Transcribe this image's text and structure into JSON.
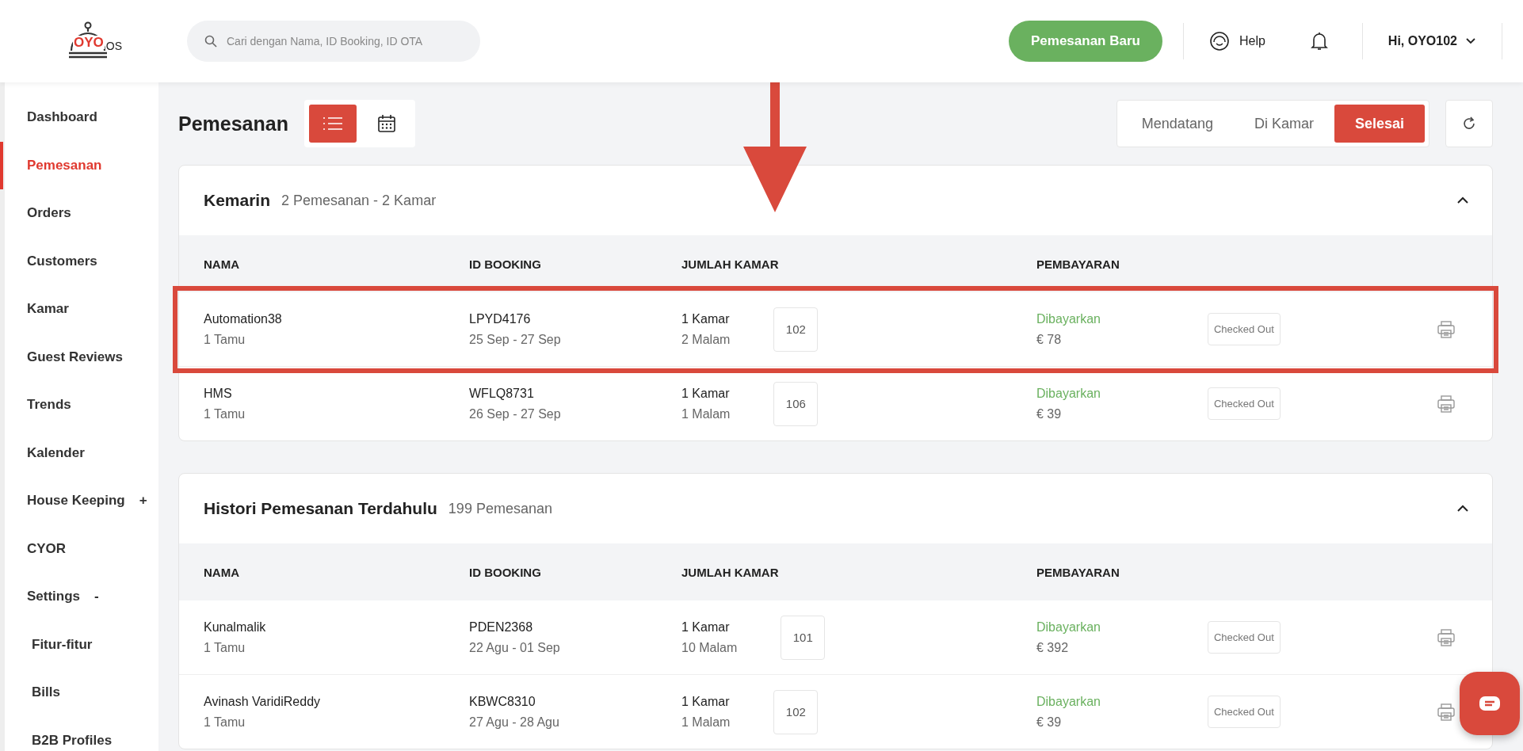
{
  "logo": {
    "brand": "OYO",
    "suffix": "OS"
  },
  "search": {
    "placeholder": "Cari dengan Nama, ID Booking, ID OTA"
  },
  "header": {
    "new_booking": "Pemesanan Baru",
    "help": "Help",
    "user": "Hi, OYO102"
  },
  "sidebar": {
    "items": [
      {
        "label": "Dashboard",
        "selected": false
      },
      {
        "label": "Pemesanan",
        "selected": true
      },
      {
        "label": "Orders",
        "selected": false
      },
      {
        "label": "Customers",
        "selected": false
      },
      {
        "label": "Kamar",
        "selected": false
      },
      {
        "label": "Guest Reviews",
        "selected": false
      },
      {
        "label": "Trends",
        "selected": false
      },
      {
        "label": "Kalender",
        "selected": false
      },
      {
        "label": "House Keeping",
        "selected": false,
        "toggle": "+"
      },
      {
        "label": "CYOR",
        "selected": false
      },
      {
        "label": "Settings",
        "selected": false,
        "toggle": "-",
        "children": [
          {
            "label": "Fitur-fitur",
            "selected": false
          },
          {
            "label": "Bills",
            "selected": false
          },
          {
            "label": "B2B Profiles",
            "selected": false
          }
        ]
      }
    ]
  },
  "page": {
    "title": "Pemesanan",
    "views": [
      {
        "kind": "list",
        "selected": true
      },
      {
        "kind": "calendar",
        "selected": false
      }
    ],
    "tabs": [
      {
        "label": "Mendatang",
        "selected": false
      },
      {
        "label": "Di Kamar",
        "selected": false
      },
      {
        "label": "Selesai",
        "selected": true
      }
    ]
  },
  "sections": [
    {
      "title": "Kemarin",
      "summary": "2 Pemesanan - 2 Kamar",
      "expanded": true,
      "columns": [
        "NAMA",
        "ID BOOKING",
        "JUMLAH KAMAR",
        "PEMBAYARAN"
      ],
      "rows": [
        {
          "name": "Automation38",
          "guests": "1 Tamu",
          "booking_id": "LPYD4176",
          "dates": "25 Sep - 27 Sep",
          "rooms": "1 Kamar",
          "nights": "2 Malam",
          "room_no": "102",
          "payment": "Dibayarkan",
          "amount": "€ 78",
          "status": "Checked Out",
          "highlighted": true
        },
        {
          "name": "HMS",
          "guests": "1 Tamu",
          "booking_id": "WFLQ8731",
          "dates": "26 Sep - 27 Sep",
          "rooms": "1 Kamar",
          "nights": "1 Malam",
          "room_no": "106",
          "payment": "Dibayarkan",
          "amount": "€ 39",
          "status": "Checked Out",
          "highlighted": false
        }
      ]
    },
    {
      "title": "Histori Pemesanan Terdahulu",
      "summary": "199 Pemesanan",
      "expanded": true,
      "columns": [
        "NAMA",
        "ID BOOKING",
        "JUMLAH KAMAR",
        "PEMBAYARAN"
      ],
      "rows": [
        {
          "name": "Kunalmalik",
          "guests": "1 Tamu",
          "booking_id": "PDEN2368",
          "dates": "22 Agu - 01 Sep",
          "rooms": "1 Kamar",
          "nights": "10 Malam",
          "room_no": "101",
          "payment": "Dibayarkan",
          "amount": "€ 392",
          "status": "Checked Out",
          "highlighted": false
        },
        {
          "name": "Avinash VaridiReddy",
          "guests": "1 Tamu",
          "booking_id": "KBWC8310",
          "dates": "27 Agu - 28 Agu",
          "rooms": "1 Kamar",
          "nights": "1 Malam",
          "room_no": "102",
          "payment": "Dibayarkan",
          "amount": "€ 39",
          "status": "Checked Out",
          "highlighted": false
        }
      ]
    }
  ],
  "annotation": {
    "arrow": true
  }
}
